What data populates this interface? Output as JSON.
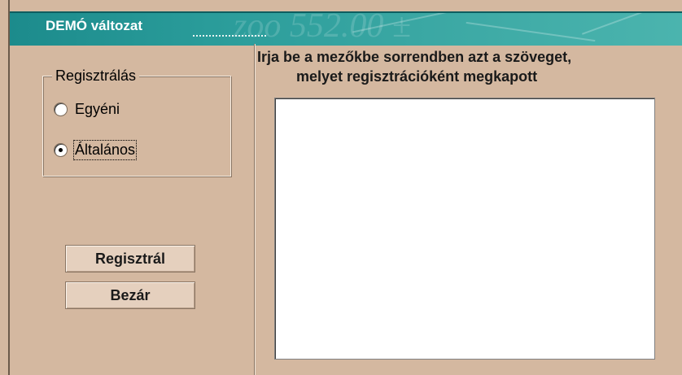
{
  "banner": {
    "title": "DEMÓ változat",
    "watermark": "zoo  552.00  ±",
    "colors": {
      "start": "#1c8b8c",
      "end": "#4bb4ae"
    }
  },
  "registration_group": {
    "legend": "Regisztrálás",
    "options": [
      {
        "label": "Egyéni",
        "checked": false
      },
      {
        "label": "Általános",
        "checked": true
      }
    ]
  },
  "buttons": {
    "register_label": "Regisztrál",
    "close_label": "Bezár"
  },
  "instruction": {
    "line1": "Irja be a mezőkbe sorrendben  azt a szöveget,",
    "line2": "melyet regisztrációként megkapott"
  },
  "code_input": {
    "value": ""
  },
  "theme": {
    "background": "#d4b8a0",
    "button_face": "#e5d0be"
  }
}
